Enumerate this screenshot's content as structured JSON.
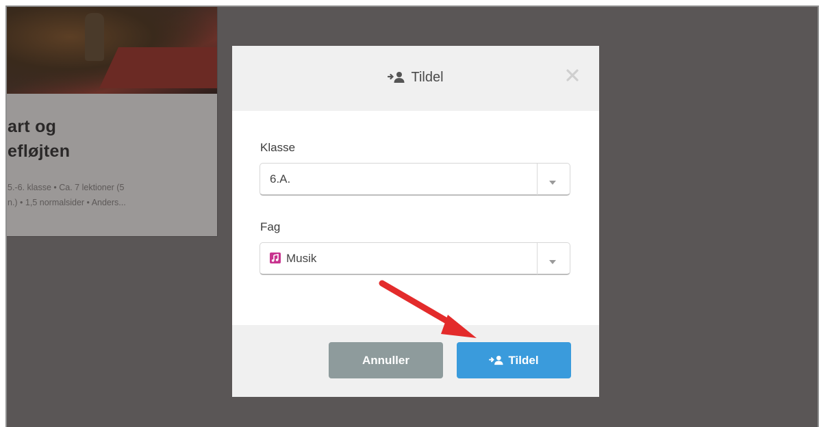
{
  "background_card": {
    "title_line1": "art og",
    "title_line2": "efløjten",
    "meta_line1": "5.-6. klasse • Ca. 7 lektioner (5",
    "meta_line2": "n.) • 1,5 normalsider • Anders..."
  },
  "modal": {
    "title": "Tildel",
    "title_icon": "assign-user-icon",
    "close_icon": "close-icon",
    "klasse": {
      "label": "Klasse",
      "value": "6.A."
    },
    "fag": {
      "label": "Fag",
      "value": "Musik",
      "icon": "music-note-icon",
      "icon_color": "#c8348f"
    },
    "buttons": {
      "cancel_label": "Annuller",
      "submit_label": "Tildel"
    }
  },
  "colors": {
    "overlay": "#5a5656",
    "primary": "#3a9bdc",
    "cancel": "#8e9b9c",
    "arrow": "#e32b2b"
  }
}
